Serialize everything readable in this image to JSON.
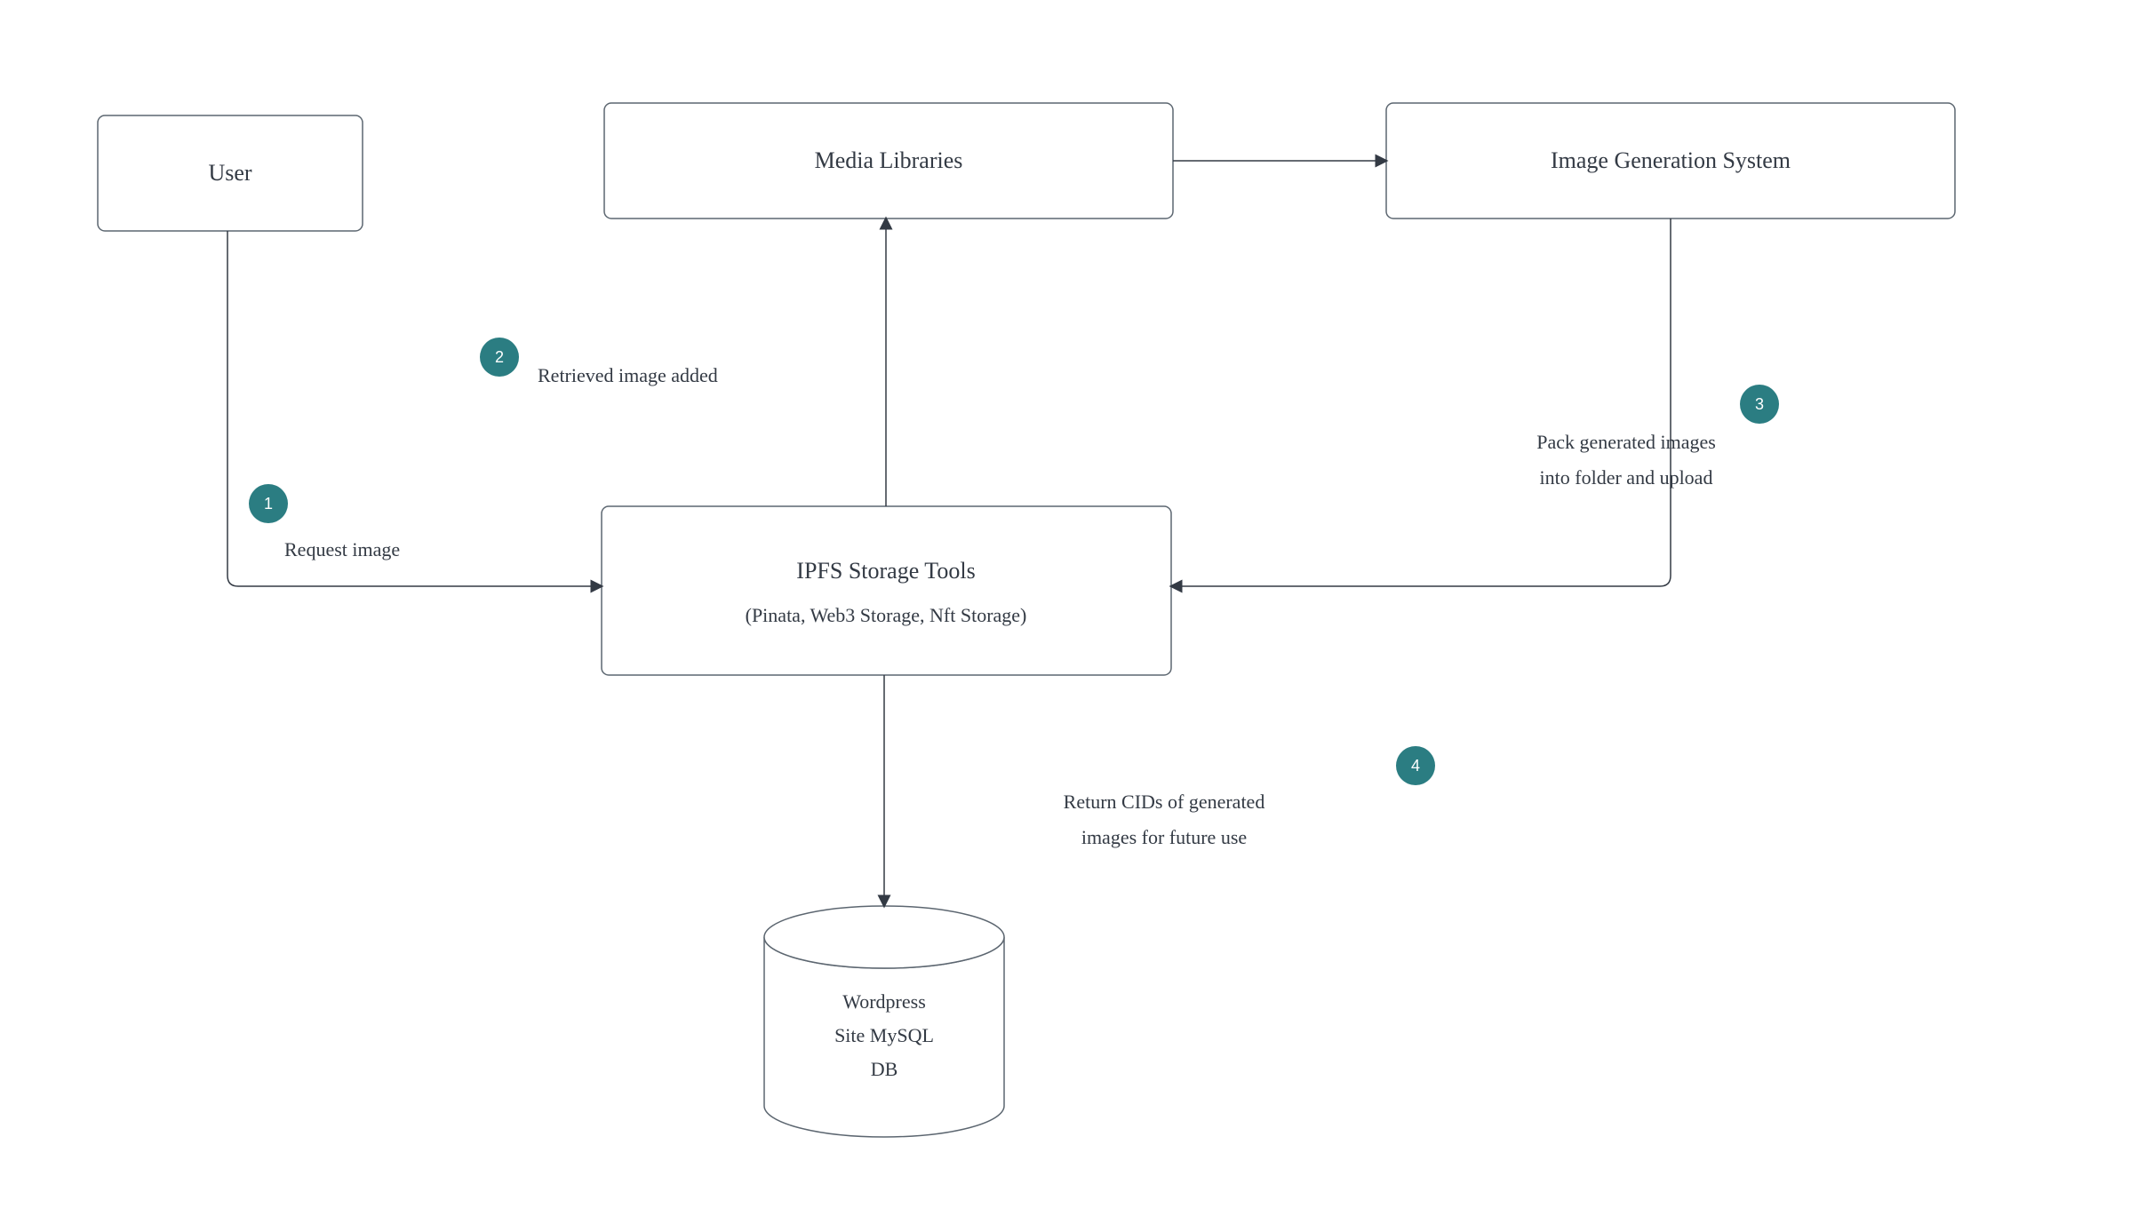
{
  "nodes": {
    "user": "User",
    "media": "Media Libraries",
    "igs": "Image Generation System",
    "ipfs_line1": "IPFS Storage Tools",
    "ipfs_line2": "(Pinata, Web3 Storage, Nft Storage)",
    "db_line1": "Wordpress",
    "db_line2": "Site MySQL",
    "db_line3": "DB"
  },
  "steps": {
    "s1": {
      "num": "1",
      "label": "Request image"
    },
    "s2": {
      "num": "2",
      "label": "Retrieved image added"
    },
    "s3": {
      "num": "3",
      "line1": "Pack generated images",
      "line2": "into folder and upload"
    },
    "s4": {
      "num": "4",
      "line1": "Return CIDs of generated",
      "line2": "images for future use"
    }
  },
  "colors": {
    "badge": "#2b7d82",
    "stroke": "#5c6670",
    "text": "#333a44"
  }
}
